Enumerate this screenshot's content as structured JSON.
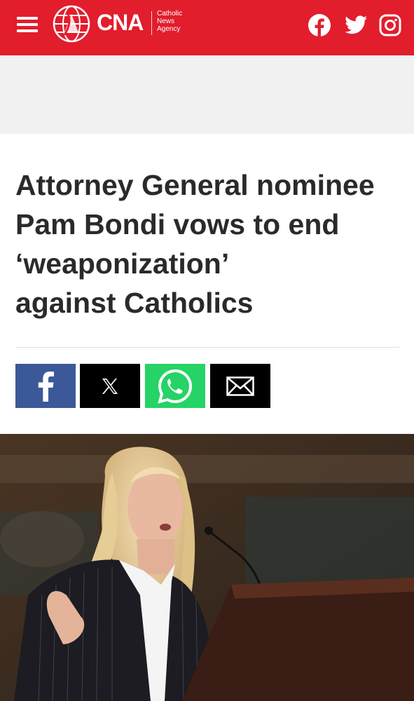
{
  "header": {
    "brand": "CNA",
    "brand_sub_line1": "Catholic",
    "brand_sub_line2": "News",
    "brand_sub_line3": "Agency",
    "bg_color": "#e21d2c",
    "icons": [
      "menu-icon",
      "globe-logo-icon",
      "facebook-icon",
      "twitter-icon",
      "instagram-icon"
    ]
  },
  "article": {
    "headline_lines": [
      "Attorney General nominee",
      "Pam Bondi vows to end",
      "‘weaponization’",
      "against Catholics"
    ]
  },
  "share_buttons": [
    {
      "name": "facebook",
      "color": "#3b5998",
      "icon": "facebook-f-icon"
    },
    {
      "name": "x",
      "color": "#000000",
      "icon": "x-icon"
    },
    {
      "name": "whatsapp",
      "color": "#25d366",
      "icon": "whatsapp-icon"
    },
    {
      "name": "email",
      "color": "#000000",
      "icon": "mail-icon"
    }
  ],
  "hero_image": {
    "description_icon": "photo-woman-speaking-at-microphone"
  }
}
